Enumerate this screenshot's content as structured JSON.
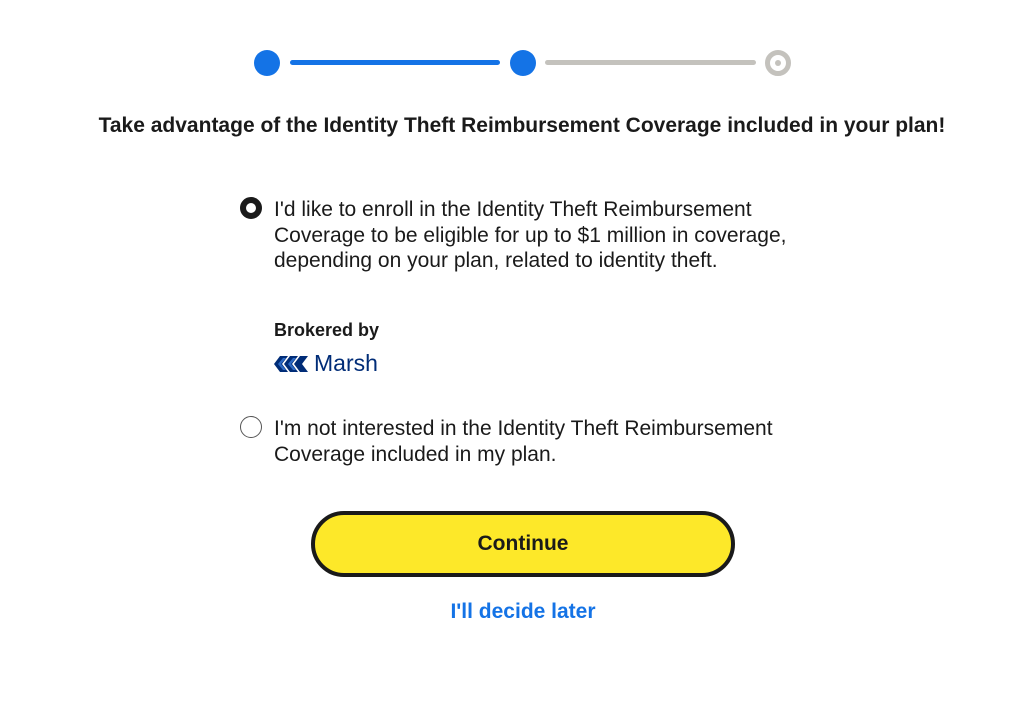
{
  "stepper": {
    "total_steps": 3,
    "current_step": 2,
    "steps": [
      {
        "state": "complete"
      },
      {
        "state": "complete"
      },
      {
        "state": "pending"
      }
    ],
    "active_color": "#1473e6",
    "inactive_color": "#c4c2bd"
  },
  "heading": "Take advantage of the Identity Theft Reimbursement Coverage included in your plan!",
  "options": {
    "enroll": {
      "label": "I'd like to enroll in the Identity Theft Reimbursement Coverage to be eligible for up to $1 million in coverage, depending on your plan, related to identity theft.",
      "selected": true
    },
    "decline": {
      "label": "I'm not interested in the Identity Theft Reimbursement Coverage included in my plan.",
      "selected": false
    }
  },
  "broker": {
    "label": "Brokered by",
    "logo_text": "Marsh",
    "logo_icon": "marsh-logo-icon",
    "logo_color": "#002c77"
  },
  "actions": {
    "continue_label": "Continue",
    "continue_color": "#fde829",
    "later_label": "I'll decide later",
    "link_color": "#1473e6"
  }
}
